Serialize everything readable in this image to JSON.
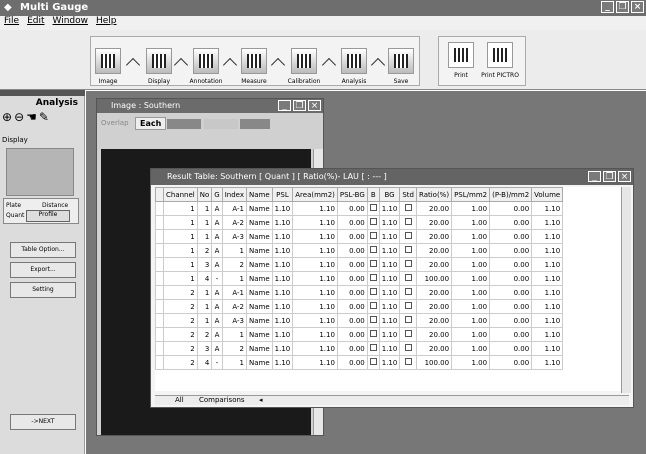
{
  "app": {
    "title": "Multi Gauge"
  },
  "menu": [
    "File",
    "Edit",
    "Window",
    "Help"
  ],
  "toolbar": {
    "image": "Image",
    "display": "Display",
    "annotation": "Annotation",
    "measure": "Measure",
    "calibration": "Calibration",
    "analysis": "Analysis",
    "save": "Save",
    "print": "Print",
    "print_pictro": "Print PICTRO"
  },
  "panel": {
    "title": "Analysis",
    "display_label": "Display",
    "tab_plate": "Plate",
    "tab_distance": "Distance",
    "tab_quant": "Quant",
    "tab_profile": "Profile",
    "table_option": "Table Option...",
    "export": "Export...",
    "setting": "Setting",
    "next": "->NEXT"
  },
  "image_window": {
    "title": "Image : Southern",
    "overlap": "Overlap",
    "each": "Each"
  },
  "result_window": {
    "title": "Result Table: Southern [ Quant ] [ Ratio(%)- LAU [ : --- ]",
    "columns": [
      "Channel",
      "No",
      "G",
      "Index",
      "Name",
      "PSL",
      "Area(mm2)",
      "PSL-BG",
      "B",
      "BG",
      "Std",
      "Ratio(%)",
      "PSL/mm2",
      "(P-B)/mm2",
      "Volume"
    ],
    "rows": [
      [
        "1",
        "1",
        "A",
        "A-1",
        "Name",
        "1.10",
        "1.10",
        "0.00",
        "",
        "1.10",
        "",
        "20.00",
        "1.00",
        "0.00",
        "1.10"
      ],
      [
        "1",
        "1",
        "A",
        "A-2",
        "Name",
        "1.10",
        "1.10",
        "0.00",
        "",
        "1.10",
        "",
        "20.00",
        "1.00",
        "0.00",
        "1.10"
      ],
      [
        "1",
        "1",
        "A",
        "A-3",
        "Name",
        "1.10",
        "1.10",
        "0.00",
        "",
        "1.10",
        "",
        "20.00",
        "1.00",
        "0.00",
        "1.10"
      ],
      [
        "1",
        "2",
        "A",
        "1",
        "Name",
        "1.10",
        "1.10",
        "0.00",
        "",
        "1.10",
        "",
        "20.00",
        "1.00",
        "0.00",
        "1.10"
      ],
      [
        "1",
        "3",
        "A",
        "2",
        "Name",
        "1.10",
        "1.10",
        "0.00",
        "",
        "1.10",
        "",
        "20.00",
        "1.00",
        "0.00",
        "1.10"
      ],
      [
        "1",
        "4",
        "-",
        "1",
        "Name",
        "1.10",
        "1.10",
        "0.00",
        "",
        "1.10",
        "",
        "100.00",
        "1.00",
        "0.00",
        "1.10"
      ],
      [
        "2",
        "1",
        "A",
        "A-1",
        "Name",
        "1.10",
        "1.10",
        "0.00",
        "",
        "1.10",
        "",
        "20.00",
        "1.00",
        "0.00",
        "1.10"
      ],
      [
        "2",
        "1",
        "A",
        "A-2",
        "Name",
        "1.10",
        "1.10",
        "0.00",
        "",
        "1.10",
        "",
        "20.00",
        "1.00",
        "0.00",
        "1.10"
      ],
      [
        "2",
        "1",
        "A",
        "A-3",
        "Name",
        "1.10",
        "1.10",
        "0.00",
        "",
        "1.10",
        "",
        "20.00",
        "1.00",
        "0.00",
        "1.10"
      ],
      [
        "2",
        "2",
        "A",
        "1",
        "Name",
        "1.10",
        "1.10",
        "0.00",
        "",
        "1.10",
        "",
        "20.00",
        "1.00",
        "0.00",
        "1.10"
      ],
      [
        "2",
        "3",
        "A",
        "2",
        "Name",
        "1.10",
        "1.10",
        "0.00",
        "",
        "1.10",
        "",
        "20.00",
        "1.00",
        "0.00",
        "1.10"
      ],
      [
        "2",
        "4",
        "-",
        "1",
        "Name",
        "1.10",
        "1.10",
        "0.00",
        "",
        "1.10",
        "",
        "100.00",
        "1.00",
        "0.00",
        "1.10"
      ]
    ],
    "sheet_tabs": [
      "All",
      "Comparisons"
    ]
  }
}
